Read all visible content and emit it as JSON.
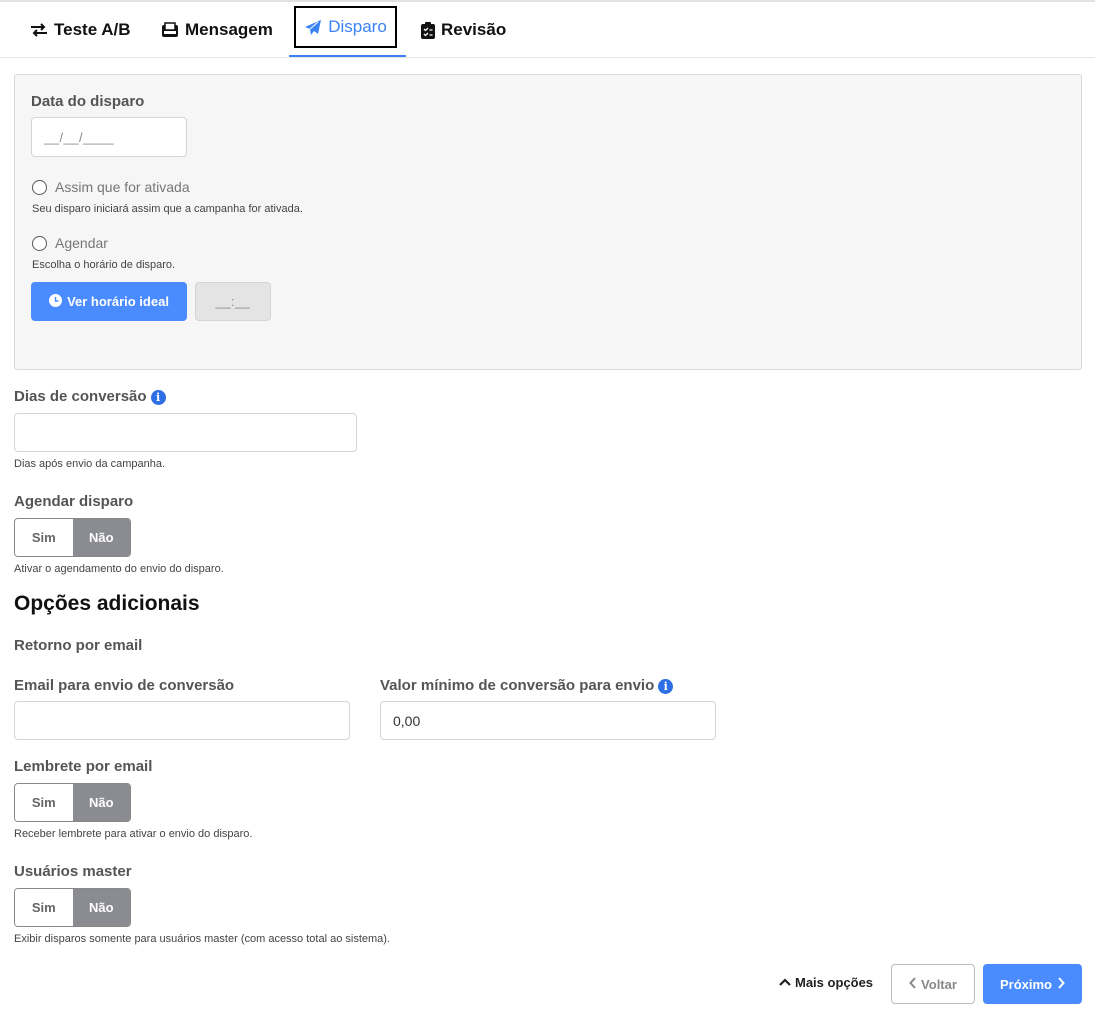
{
  "tabs": [
    {
      "label": "Teste A/B",
      "icon": "swap-arrows-icon"
    },
    {
      "label": "Mensagem",
      "icon": "inbox-icon"
    },
    {
      "label": "Disparo",
      "icon": "paper-plane-icon",
      "active": true
    },
    {
      "label": "Revisão",
      "icon": "clipboard-check-icon"
    }
  ],
  "disparo": {
    "date_label": "Data do disparo",
    "date_placeholder": "__/__/____",
    "option_immediate": "Assim que for ativada",
    "option_immediate_help": "Seu disparo iniciará assim que a campanha for ativada.",
    "option_schedule": "Agendar",
    "option_schedule_help": "Escolha o horário de disparo.",
    "ideal_time_button": "Ver horário ideal",
    "time_placeholder": "__:__"
  },
  "conversion": {
    "label": "Dias de conversão",
    "value": "",
    "help": "Dias após envio da campanha."
  },
  "schedule_toggle": {
    "label": "Agendar disparo",
    "yes": "Sim",
    "no": "Não",
    "selected": "Não",
    "help": "Ativar o agendamento do envio do disparo."
  },
  "additional": {
    "title": "Opções adicionais",
    "email_return_label": "Retorno por email",
    "conversion_email_label": "Email para envio de conversão",
    "conversion_email_value": "",
    "min_value_label": "Valor mínimo de conversão para envio",
    "min_value": "0,00",
    "reminder": {
      "label": "Lembrete por email",
      "yes": "Sim",
      "no": "Não",
      "selected": "Não",
      "help": "Receber lembrete para ativar o envio do disparo."
    },
    "master": {
      "label": "Usuários master",
      "yes": "Sim",
      "no": "Não",
      "selected": "Não",
      "help": "Exibir disparos somente para usuários master (com acesso total ao sistema)."
    }
  },
  "footer": {
    "more_options": "Mais opções",
    "back": "Voltar",
    "next": "Próximo"
  },
  "colors": {
    "accent": "#4a8cff",
    "active_tab": "#3b82f6",
    "toggle_selected": "#8a8c91",
    "info_icon": "#2f6fe4"
  }
}
